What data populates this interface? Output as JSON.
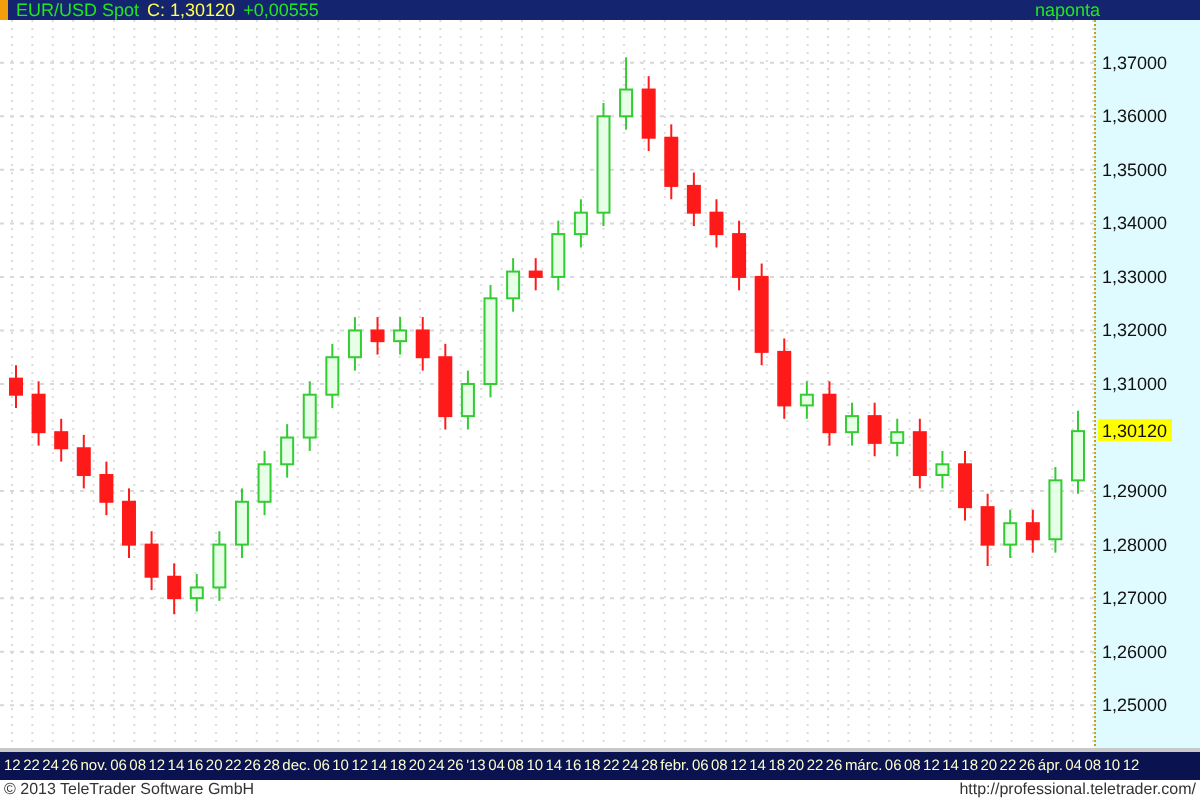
{
  "header": {
    "symbol": "EUR/USD Spot",
    "close": "C: 1,30120",
    "change": "+0,00555",
    "period": "naponta"
  },
  "chart": {
    "price_axis_labels": [
      "1,37000",
      "1,36000",
      "1,35000",
      "1,34000",
      "1,33000",
      "1,32000",
      "1,31000",
      "1,29000",
      "1,28000",
      "1,27000",
      "1,26000",
      "1,25000"
    ],
    "current_price_label": "1,30120",
    "date_axis_labels": [
      "12",
      "22",
      "24",
      "26",
      "nov.",
      "06",
      "08",
      "12",
      "14",
      "16",
      "20",
      "22",
      "26",
      "28",
      "dec.",
      "06",
      "10",
      "12",
      "14",
      "18",
      "20",
      "24",
      "26",
      "'13",
      "04",
      "08",
      "10",
      "14",
      "16",
      "18",
      "22",
      "24",
      "28",
      "febr.",
      "06",
      "08",
      "12",
      "14",
      "18",
      "20",
      "22",
      "26",
      "márc.",
      "06",
      "08",
      "12",
      "14",
      "18",
      "20",
      "22",
      "26",
      "ápr.",
      "04",
      "08",
      "10",
      "12"
    ]
  },
  "footer": {
    "copyright": "© 2013 TeleTrader Software GmbH",
    "url": "http://professional.teletrader.com/"
  }
}
